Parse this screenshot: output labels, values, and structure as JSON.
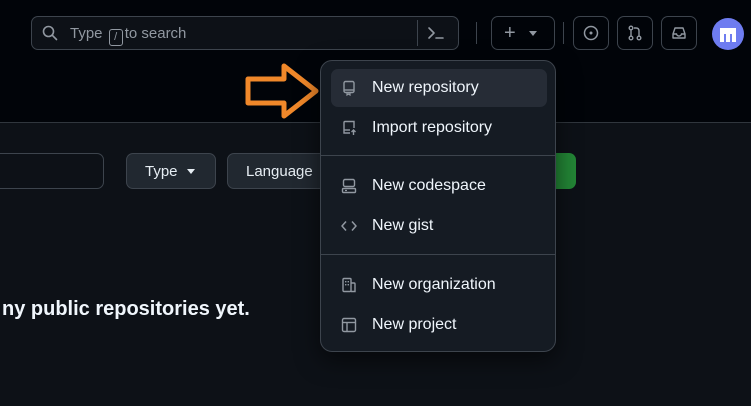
{
  "header": {
    "search": {
      "placeholder_pre": "Type",
      "kbd": "/",
      "placeholder_post": "to search"
    },
    "create_button_label": "+"
  },
  "toolbar": {
    "type_label": "Type",
    "language_label": "Language"
  },
  "main": {
    "empty_message": "ny public repositories yet."
  },
  "create_menu": {
    "items": [
      {
        "label": "New repository",
        "icon": "repo-icon"
      },
      {
        "label": "Import repository",
        "icon": "repo-push-icon"
      },
      {
        "label": "New codespace",
        "icon": "codespaces-icon"
      },
      {
        "label": "New gist",
        "icon": "code-icon"
      },
      {
        "label": "New organization",
        "icon": "organization-icon"
      },
      {
        "label": "New project",
        "icon": "project-icon"
      }
    ]
  },
  "colors": {
    "background": "#0d1117",
    "menu_background": "#151b23",
    "highlight": "#262c36",
    "arrow_annotation": "#f0882a",
    "primary_button": "#238636"
  }
}
